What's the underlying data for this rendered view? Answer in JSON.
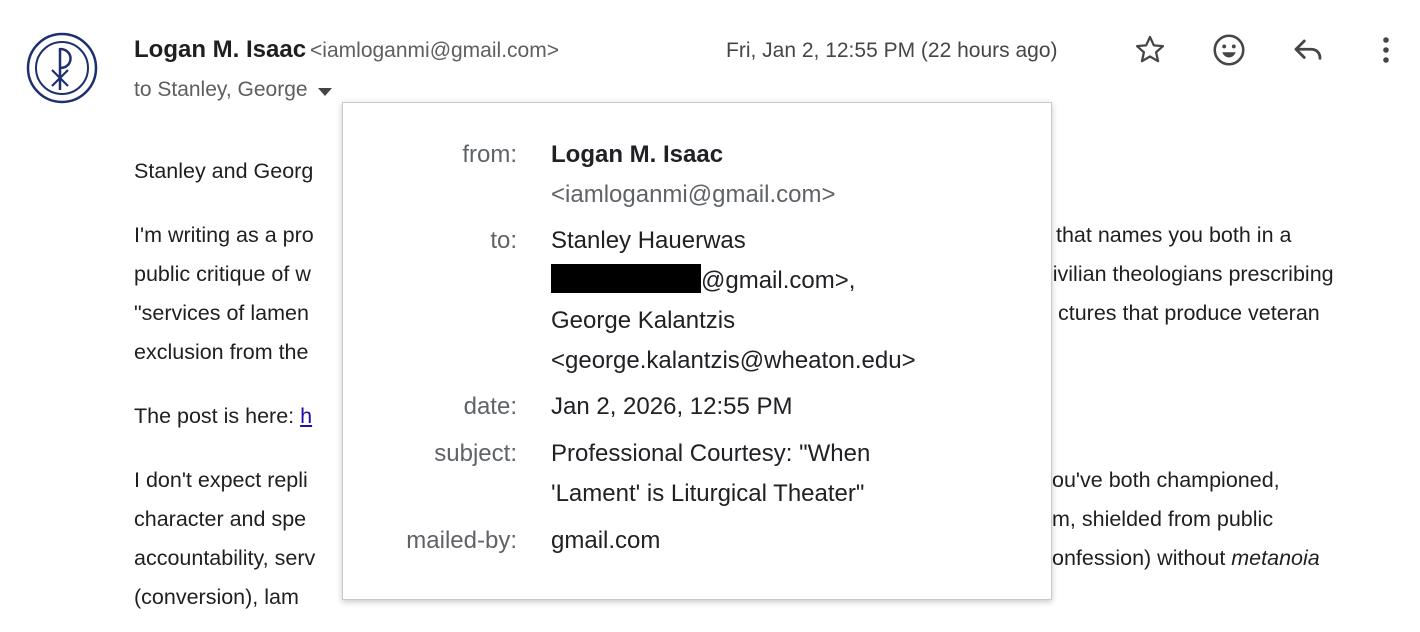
{
  "header": {
    "sender_name": "Logan M. Isaac",
    "sender_email": "<iamloganmi@gmail.com>",
    "to_summary": "to Stanley, George",
    "date": "Fri, Jan 2, 12:55 PM (22 hours ago)"
  },
  "icons": {
    "avatar": "chi-rho-icon",
    "star": "star-icon",
    "emoji": "emoji-icon",
    "reply": "reply-icon",
    "more": "more-vert-icon",
    "caret": "chevron-down-icon"
  },
  "body": {
    "greeting": "Stanley and Georg",
    "p1_l1_left": "I'm writing as a pro",
    "p1_l1_right": "that names you both in a",
    "p1_l2_left": "public critique of w",
    "p1_l2_right": "civilian theologians prescribing",
    "p1_l3_left": "\"services of lamen",
    "p1_l3_right": "ctures that produce veteran",
    "p1_l4_left": "exclusion from the",
    "p2_left": "The post is here: ",
    "p2_link": "h",
    "p3_l1_left": "I don't expect repli",
    "p3_l1_right": "ou've both championed,",
    "p3_l2_left": "character and spe",
    "p3_l2_right": "m, shielded from public",
    "p3_l3_left": "accountability, serv",
    "p3_l3_right_a": "onfession) without ",
    "p3_l3_right_b": "metanoia",
    "p3_l4_left": "(conversion), lam"
  },
  "details": {
    "from_label": "from:",
    "from_name": "Logan M. Isaac",
    "from_email": "<iamloganmi@gmail.com>",
    "to_label": "to:",
    "to_name1": "Stanley Hauerwas",
    "to_email1_suffix": "@gmail.com>,",
    "to_name2": "George Kalantzis",
    "to_email2": "<george.kalantzis@wheaton.edu>",
    "date_label": "date:",
    "date_value": "Jan 2, 2026, 12:55 PM",
    "subject_label": "subject:",
    "subject_l1": "Professional Courtesy: \"When",
    "subject_l2": "'Lament' is Liturgical Theater\"",
    "mailedby_label": "mailed-by:",
    "mailedby_value": "gmail.com"
  },
  "colors": {
    "avatar_navy": "#1d2f6f",
    "link": "#1a0dab"
  }
}
